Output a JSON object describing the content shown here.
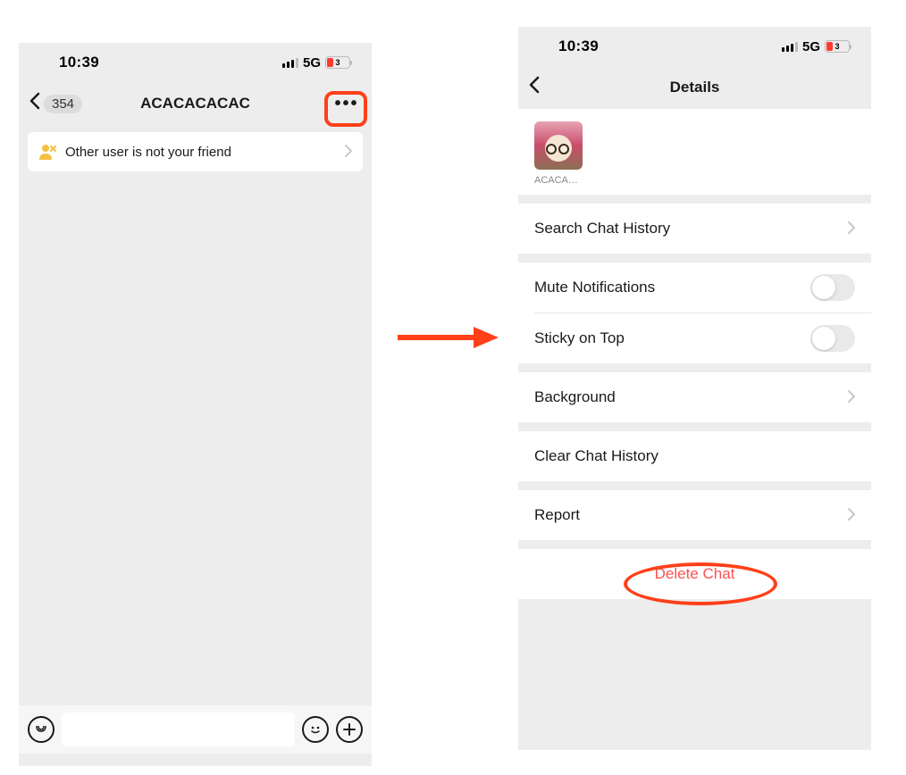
{
  "status": {
    "time": "10:39",
    "network": "5G",
    "battery_symbol": "3"
  },
  "chat": {
    "unread": "354",
    "title": "ACACACACAC",
    "notice": "Other user is not your friend",
    "more_dots": "•••"
  },
  "details": {
    "title": "Details",
    "avatar_label": "ACACA…",
    "items": {
      "search": "Search Chat History",
      "mute": "Mute Notifications",
      "sticky": "Sticky on Top",
      "background": "Background",
      "clear": "Clear Chat History",
      "report": "Report",
      "delete": "Delete Chat"
    }
  }
}
